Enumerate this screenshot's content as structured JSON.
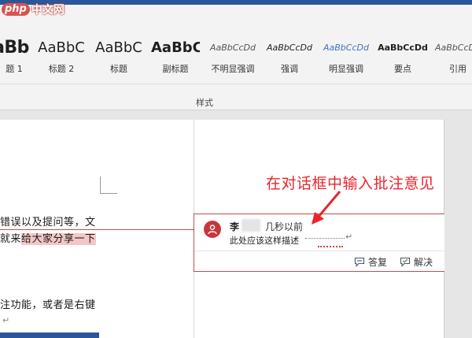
{
  "watermark": {
    "logo": "php",
    "text": "中文网"
  },
  "ribbon": {
    "group_label": "样式",
    "styles": [
      {
        "preview": "aBb",
        "label": "题 1"
      },
      {
        "preview": "AaBbC",
        "label": "标题 2"
      },
      {
        "preview": "AaBbC",
        "label": "标题"
      },
      {
        "preview": "AaBbC",
        "label": "副标题"
      },
      {
        "preview": "AaBbCcDd",
        "label": "不明显强调"
      },
      {
        "preview": "AaBbCcDd",
        "label": "强调"
      },
      {
        "preview": "AaBbCcDd",
        "label": "明显强调"
      },
      {
        "preview": "AaBbCcDd",
        "label": "要点"
      },
      {
        "preview": "AaBbCcDd",
        "label": "引用"
      }
    ]
  },
  "document": {
    "line1": "错误以及提问等，文",
    "line2_plain": "就来",
    "line2_highlight": "给大家分享一下",
    "line3": "注功能，或者是右键",
    "paragraph_mark": "↵"
  },
  "comment": {
    "author": "李",
    "time": "几秒以前",
    "text": "此处应该这样描述",
    "cursor": "↵",
    "reply_label": "答复",
    "resolve_label": "解决"
  },
  "annotation": {
    "callout": "在对话框中输入批注意见"
  },
  "colors": {
    "accent": "#2b579a",
    "comment_border": "#c0504d",
    "avatar": "#c7363e",
    "callout": "#e8262b",
    "highlight": "#f4c6c6"
  }
}
